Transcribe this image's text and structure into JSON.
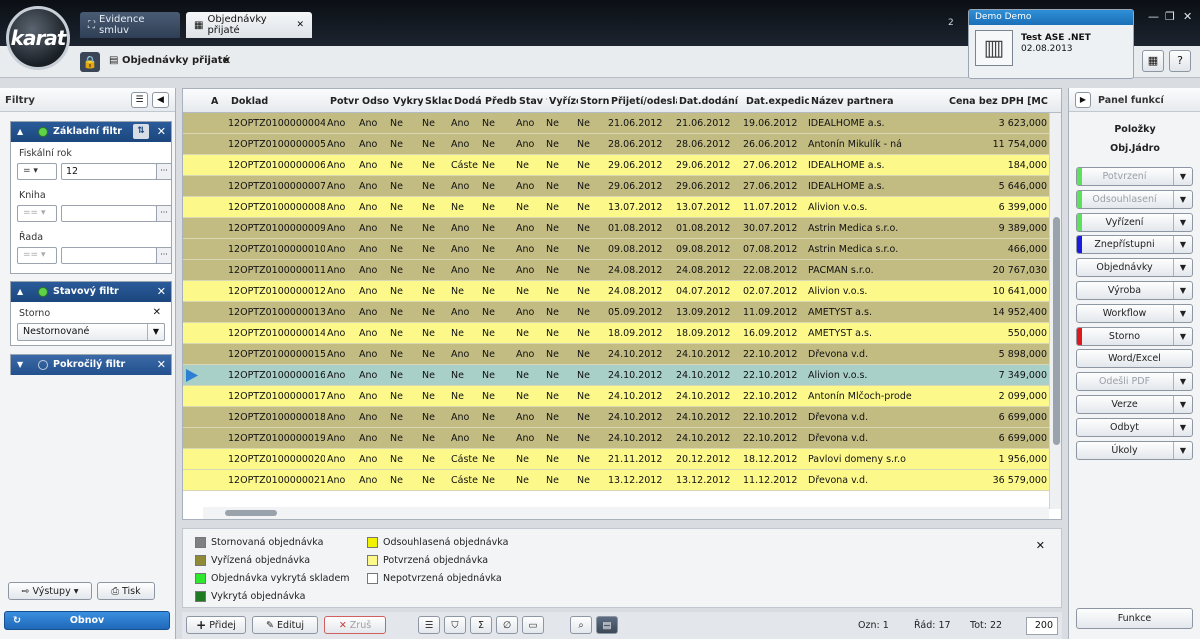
{
  "app": {
    "logo_text": "karat",
    "tabs": [
      {
        "label": "Evidence smluv"
      },
      {
        "label": "Objednávky přijaté"
      }
    ],
    "header_digit": "2",
    "user": {
      "title": "Demo Demo",
      "company": "Test ASE .NET",
      "date": "02.08.2013"
    },
    "breadcrumb": "Objednávky přijaté"
  },
  "filters": {
    "title": "Filtry",
    "basic": {
      "title": "Základní filtr",
      "fiscal_label": "Fiskální rok",
      "fiscal_op": "=",
      "fiscal_value": "12",
      "book_label": "Kniha",
      "book_op": "==",
      "row_label": "Řada",
      "row_op": "=="
    },
    "status": {
      "title": "Stavový filtr",
      "storno_label": "Storno",
      "storno_value": "Nestornované"
    },
    "advanced": {
      "title": "Pokročilý filtr"
    },
    "outputs_label": "Výstupy",
    "print_label": "Tisk",
    "refresh_label": "Obnov"
  },
  "grid": {
    "columns": [
      "A",
      "Doklad",
      "Potvr",
      "Odso",
      "Vykry",
      "Sklad",
      "Dodá",
      "Předb",
      "Stav v",
      "Vyříze",
      "Storn",
      "Přijetí/odeslá",
      "Dat.dodání",
      "Dat.expedice",
      "Název partnera",
      "Cena bez DPH [MC"
    ],
    "rows": [
      {
        "doklad": "12OPTZ0100000004",
        "vals": [
          "Ano",
          "Ano",
          "Ne",
          "Ne",
          "Ano",
          "Ne",
          "Ano",
          "Ne",
          "Ne"
        ],
        "prijeti": "21.06.2012",
        "dodani": "21.06.2012",
        "expedice": "19.06.2012",
        "partner": "IDEALHOME a.s.",
        "cena": "3 623,000",
        "color": "#c2bb82"
      },
      {
        "doklad": "12OPTZ0100000005",
        "vals": [
          "Ano",
          "Ano",
          "Ne",
          "Ne",
          "Ano",
          "Ne",
          "Ano",
          "Ne",
          "Ne"
        ],
        "prijeti": "28.06.2012",
        "dodani": "28.06.2012",
        "expedice": "26.06.2012",
        "partner": "Antonín Mikulík - ná",
        "cena": "11 754,000",
        "color": "#c2bb82"
      },
      {
        "doklad": "12OPTZ0100000006",
        "vals": [
          "Ano",
          "Ano",
          "Ne",
          "Ne",
          "Částe",
          "Ne",
          "Ne",
          "Ne",
          "Ne"
        ],
        "prijeti": "29.06.2012",
        "dodani": "29.06.2012",
        "expedice": "27.06.2012",
        "partner": "IDEALHOME a.s.",
        "cena": "184,000",
        "color": "#fcf98a"
      },
      {
        "doklad": "12OPTZ0100000007",
        "vals": [
          "Ano",
          "Ano",
          "Ne",
          "Ne",
          "Ano",
          "Ne",
          "Ano",
          "Ne",
          "Ne"
        ],
        "prijeti": "29.06.2012",
        "dodani": "29.06.2012",
        "expedice": "27.06.2012",
        "partner": "IDEALHOME a.s.",
        "cena": "5 646,000",
        "color": "#c2bb82"
      },
      {
        "doklad": "12OPTZ0100000008",
        "vals": [
          "Ano",
          "Ano",
          "Ne",
          "Ne",
          "Ne",
          "Ne",
          "Ne",
          "Ne",
          "Ne"
        ],
        "prijeti": "13.07.2012",
        "dodani": "13.07.2012",
        "expedice": "11.07.2012",
        "partner": "Alivion v.o.s.",
        "cena": "6 399,000",
        "color": "#fcf98a"
      },
      {
        "doklad": "12OPTZ0100000009",
        "vals": [
          "Ano",
          "Ano",
          "Ne",
          "Ne",
          "Ano",
          "Ne",
          "Ano",
          "Ne",
          "Ne"
        ],
        "prijeti": "01.08.2012",
        "dodani": "01.08.2012",
        "expedice": "30.07.2012",
        "partner": "Astrin Medica s.r.o.",
        "cena": "9 389,000",
        "color": "#c2bb82"
      },
      {
        "doklad": "12OPTZ0100000010",
        "vals": [
          "Ano",
          "Ano",
          "Ne",
          "Ne",
          "Ano",
          "Ne",
          "Ano",
          "Ne",
          "Ne"
        ],
        "prijeti": "09.08.2012",
        "dodani": "09.08.2012",
        "expedice": "07.08.2012",
        "partner": "Astrin Medica s.r.o.",
        "cena": "466,000",
        "color": "#c2bb82"
      },
      {
        "doklad": "12OPTZ0100000011",
        "vals": [
          "Ano",
          "Ano",
          "Ne",
          "Ne",
          "Ano",
          "Ne",
          "Ano",
          "Ne",
          "Ne"
        ],
        "prijeti": "24.08.2012",
        "dodani": "24.08.2012",
        "expedice": "22.08.2012",
        "partner": "PACMAN s.r.o.",
        "cena": "20 767,030",
        "color": "#c2bb82"
      },
      {
        "doklad": "12OPTZ0100000012",
        "vals": [
          "Ano",
          "Ano",
          "Ne",
          "Ne",
          "Ne",
          "Ne",
          "Ne",
          "Ne",
          "Ne"
        ],
        "prijeti": "24.08.2012",
        "dodani": "04.07.2012",
        "expedice": "02.07.2012",
        "partner": "Alivion v.o.s.",
        "cena": "10 641,000",
        "color": "#fcf98a"
      },
      {
        "doklad": "12OPTZ0100000013",
        "vals": [
          "Ano",
          "Ano",
          "Ne",
          "Ne",
          "Ano",
          "Ne",
          "Ano",
          "Ne",
          "Ne"
        ],
        "prijeti": "05.09.2012",
        "dodani": "13.09.2012",
        "expedice": "11.09.2012",
        "partner": "AMETYST a.s.",
        "cena": "14 952,400",
        "color": "#c2bb82"
      },
      {
        "doklad": "12OPTZ0100000014",
        "vals": [
          "Ano",
          "Ano",
          "Ne",
          "Ne",
          "Ne",
          "Ne",
          "Ne",
          "Ne",
          "Ne"
        ],
        "prijeti": "18.09.2012",
        "dodani": "18.09.2012",
        "expedice": "16.09.2012",
        "partner": "AMETYST a.s.",
        "cena": "550,000",
        "color": "#fcf98a"
      },
      {
        "doklad": "12OPTZ0100000015",
        "vals": [
          "Ano",
          "Ano",
          "Ne",
          "Ne",
          "Ano",
          "Ne",
          "Ano",
          "Ne",
          "Ne"
        ],
        "prijeti": "24.10.2012",
        "dodani": "24.10.2012",
        "expedice": "22.10.2012",
        "partner": "Dřevona v.d.",
        "cena": "5 898,000",
        "color": "#c2bb82"
      },
      {
        "doklad": "12OPTZ0100000016",
        "vals": [
          "Ano",
          "Ano",
          "Ne",
          "Ne",
          "Ne",
          "Ne",
          "Ne",
          "Ne",
          "Ne"
        ],
        "prijeti": "24.10.2012",
        "dodani": "24.10.2012",
        "expedice": "22.10.2012",
        "partner": "Alivion v.o.s.",
        "cena": "7 349,000",
        "color": "#a9cfc9",
        "selected": true
      },
      {
        "doklad": "12OPTZ0100000017",
        "vals": [
          "Ano",
          "Ano",
          "Ne",
          "Ne",
          "Ne",
          "Ne",
          "Ne",
          "Ne",
          "Ne"
        ],
        "prijeti": "24.10.2012",
        "dodani": "24.10.2012",
        "expedice": "22.10.2012",
        "partner": "Antonín Mlčoch-prode",
        "cena": "2 099,000",
        "color": "#fcf98a"
      },
      {
        "doklad": "12OPTZ0100000018",
        "vals": [
          "Ano",
          "Ano",
          "Ne",
          "Ne",
          "Ano",
          "Ne",
          "Ano",
          "Ne",
          "Ne"
        ],
        "prijeti": "24.10.2012",
        "dodani": "24.10.2012",
        "expedice": "22.10.2012",
        "partner": "Dřevona v.d.",
        "cena": "6 699,000",
        "color": "#c2bb82"
      },
      {
        "doklad": "12OPTZ0100000019",
        "vals": [
          "Ano",
          "Ano",
          "Ne",
          "Ne",
          "Ano",
          "Ne",
          "Ano",
          "Ne",
          "Ne"
        ],
        "prijeti": "24.10.2012",
        "dodani": "24.10.2012",
        "expedice": "22.10.2012",
        "partner": "Dřevona v.d.",
        "cena": "6 699,000",
        "color": "#c2bb82"
      },
      {
        "doklad": "12OPTZ0100000020",
        "vals": [
          "Ano",
          "Ano",
          "Ne",
          "Ne",
          "Částe",
          "Ne",
          "Ne",
          "Ne",
          "Ne"
        ],
        "prijeti": "21.11.2012",
        "dodani": "20.12.2012",
        "expedice": "18.12.2012",
        "partner": "Pavlovi domeny s.r.o",
        "cena": "1 956,000",
        "color": "#fcf98a"
      },
      {
        "doklad": "12OPTZ0100000021",
        "vals": [
          "Ano",
          "Ano",
          "Ne",
          "Ne",
          "Částe",
          "Ne",
          "Ne",
          "Ne",
          "Ne"
        ],
        "prijeti": "13.12.2012",
        "dodani": "13.12.2012",
        "expedice": "11.12.2012",
        "partner": "Dřevona v.d.",
        "cena": "36 579,000",
        "color": "#fcf98a"
      }
    ]
  },
  "legend": [
    {
      "label": "Stornovaná objednávka",
      "color": "#808080"
    },
    {
      "label": "Vyřízená objednávka",
      "color": "#8f8a35"
    },
    {
      "label": "Objednávka vykrytá skladem",
      "color": "#2ee82e"
    },
    {
      "label": "Vykrytá objednávka",
      "color": "#1f7a1f"
    },
    {
      "label": "Odsouhlasená objednávka",
      "color": "#f2f200"
    },
    {
      "label": "Potvrzená objednávka",
      "color": "#fcf98a"
    },
    {
      "label": "Nepotvrzená objednávka",
      "color": "#ffffff"
    }
  ],
  "toolbar": {
    "add_label": "Přidej",
    "edit_label": "Edituj",
    "cancel_label": "Zruš",
    "marked": "Ozn: 1",
    "row": "Řád: 17",
    "total": "Tot: 22",
    "page_size": "200"
  },
  "right_panel": {
    "title": "Panel funkcí",
    "sub1": "Položky",
    "sub2": "Obj.Jádro",
    "buttons": [
      {
        "label": "Potvrzení",
        "disabled": true,
        "dropdown": true,
        "stripe": "#5ee05e"
      },
      {
        "label": "Odsouhlasení",
        "disabled": true,
        "dropdown": true,
        "stripe": "#5ee05e"
      },
      {
        "label": "Vyřízení",
        "disabled": false,
        "dropdown": true,
        "stripe": "#5ee05e"
      },
      {
        "label": "Znepřístupni",
        "disabled": false,
        "dropdown": true,
        "stripe": "#1a1ae0"
      },
      {
        "label": "Objednávky",
        "disabled": false,
        "dropdown": true
      },
      {
        "label": "Výroba",
        "disabled": false,
        "dropdown": true
      },
      {
        "label": "Workflow",
        "disabled": false,
        "dropdown": true
      },
      {
        "label": "Storno",
        "disabled": false,
        "dropdown": true,
        "stripe": "#e01818"
      },
      {
        "label": "Word/Excel",
        "disabled": false,
        "dropdown": false
      },
      {
        "label": "Odešli PDF",
        "disabled": true,
        "dropdown": true
      },
      {
        "label": "Verze",
        "disabled": false,
        "dropdown": true
      },
      {
        "label": "Odbyt",
        "disabled": false,
        "dropdown": true
      },
      {
        "label": "Úkoly",
        "disabled": false,
        "dropdown": true
      }
    ],
    "funkce_label": "Funkce"
  }
}
